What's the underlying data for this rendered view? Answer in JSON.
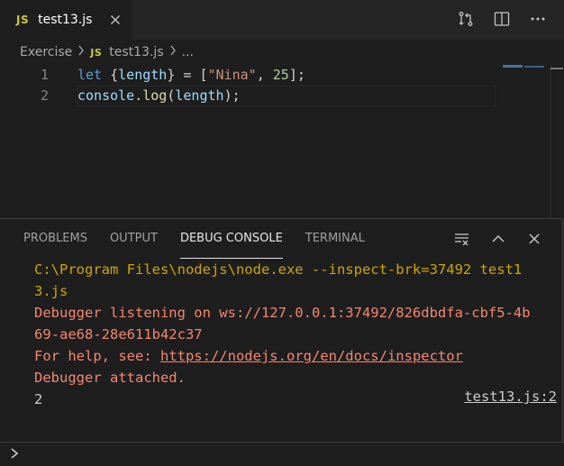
{
  "tab": {
    "badge": "JS",
    "title": "test13.js"
  },
  "breadcrumb": {
    "folder": "Exercise",
    "file_badge": "JS",
    "file": "test13.js",
    "more": "..."
  },
  "editor": {
    "lines": [
      {
        "num": "1",
        "tokens": [
          {
            "t": "let ",
            "c": "kw"
          },
          {
            "t": "{",
            "c": "punc"
          },
          {
            "t": "length",
            "c": "var"
          },
          {
            "t": "} = [",
            "c": "punc"
          },
          {
            "t": "\"Nina\"",
            "c": "str"
          },
          {
            "t": ", ",
            "c": "punc"
          },
          {
            "t": "25",
            "c": "num"
          },
          {
            "t": "];",
            "c": "punc"
          }
        ]
      },
      {
        "num": "2",
        "tokens": [
          {
            "t": "console",
            "c": "var"
          },
          {
            "t": ".",
            "c": "punc"
          },
          {
            "t": "log",
            "c": "fn"
          },
          {
            "t": "(",
            "c": "punc"
          },
          {
            "t": "length",
            "c": "var"
          },
          {
            "t": ");",
            "c": "punc"
          }
        ]
      }
    ]
  },
  "panel": {
    "tabs": [
      {
        "label": "PROBLEMS",
        "active": false
      },
      {
        "label": "OUTPUT",
        "active": false
      },
      {
        "label": "DEBUG CONSOLE",
        "active": true
      },
      {
        "label": "TERMINAL",
        "active": false
      }
    ],
    "console": {
      "line1": "C:\\Program Files\\nodejs\\node.exe --inspect-brk=37492 test1",
      "line2": "3.js",
      "line3": "Debugger listening on ws://127.0.0.1:37492/826dbdfa-cbf5-4b",
      "line4": "69-ae68-28e611b42c37",
      "line5_prefix": "For help, see: ",
      "line5_link": "https://nodejs.org/en/docs/inspector",
      "line6": "Debugger attached.",
      "output_value": "2",
      "source_link": "test13.js:2"
    }
  },
  "colors": {
    "background": "#1e1e1e",
    "accent": "#cca700",
    "error": "#f48771"
  }
}
